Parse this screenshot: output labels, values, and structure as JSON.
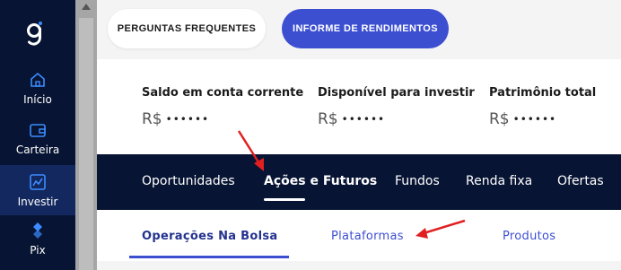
{
  "sidebar": {
    "items": [
      {
        "label": "Início",
        "icon": "home-icon"
      },
      {
        "label": "Carteira",
        "icon": "wallet-icon"
      },
      {
        "label": "Investir",
        "icon": "chart-icon",
        "active": true
      },
      {
        "label": "Pix",
        "icon": "pix-icon"
      }
    ]
  },
  "topbar": {
    "faq_label": "PERGUNTAS FREQUENTES",
    "income_label": "INFORME DE RENDIMENTOS"
  },
  "balances": [
    {
      "label": "Saldo em conta corrente",
      "currency": "R$",
      "masked": "••••••"
    },
    {
      "label": "Disponível para investir",
      "currency": "R$",
      "masked": "••••••"
    },
    {
      "label": "Patrimônio total",
      "currency": "R$",
      "masked": "••••••"
    }
  ],
  "tabs": [
    {
      "label": "Oportunidades"
    },
    {
      "label": "Ações e Futuros",
      "active": true
    },
    {
      "label": "Fundos"
    },
    {
      "label": "Renda fixa"
    },
    {
      "label": "Ofertas"
    }
  ],
  "subtabs": [
    {
      "label": "Operações Na Bolsa",
      "active": true
    },
    {
      "label": "Plataformas"
    },
    {
      "label": "Produtos"
    }
  ],
  "colors": {
    "sidebar_bg": "#071433",
    "accent": "#3c4fd1",
    "annotation_arrow": "#e02020"
  }
}
